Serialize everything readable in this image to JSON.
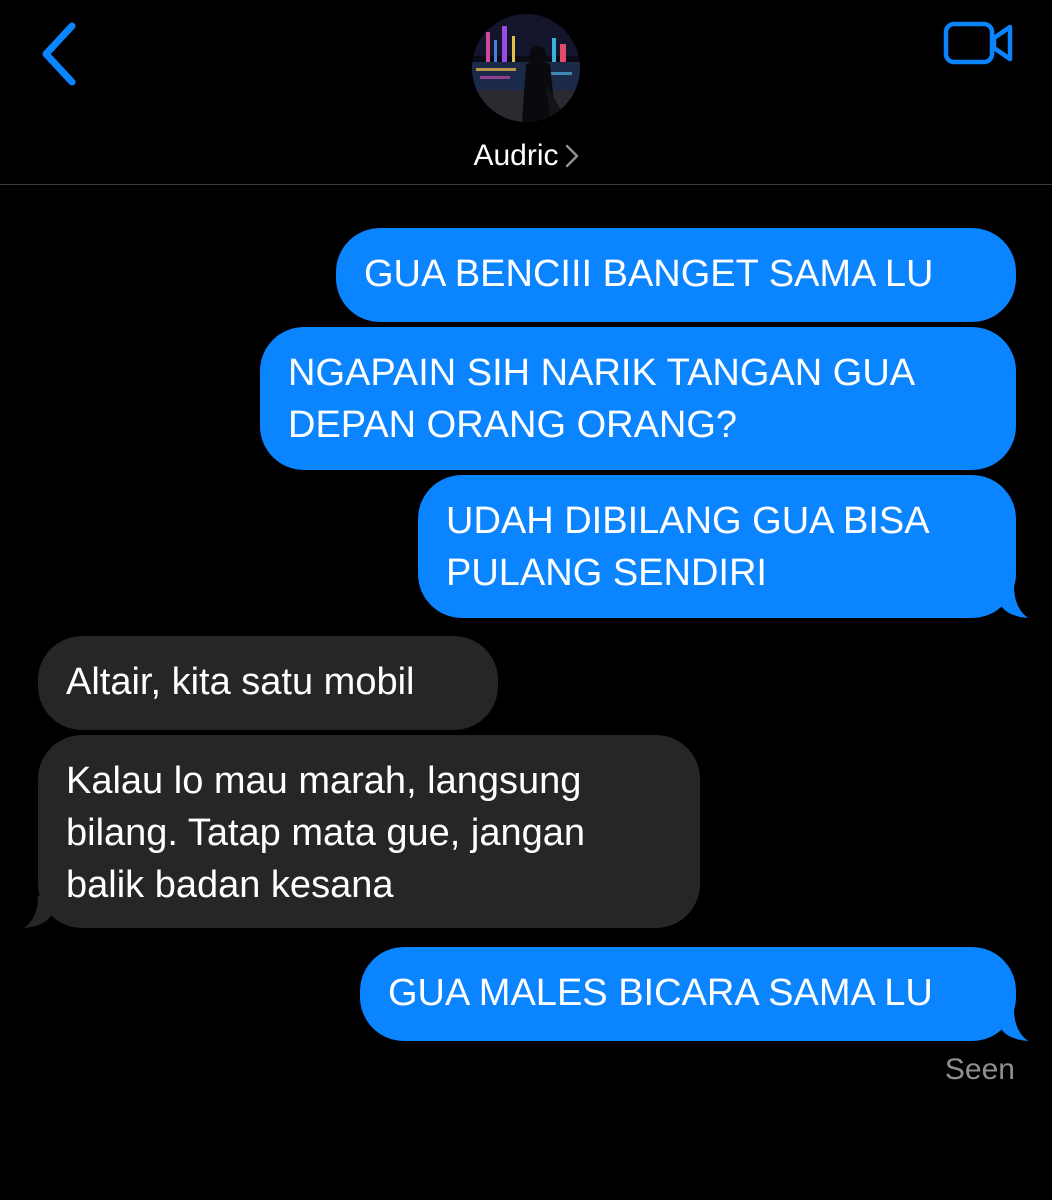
{
  "contact": {
    "name": "Audric"
  },
  "header": {
    "back_icon": "chevron-left-icon",
    "video_icon": "video-camera-icon",
    "accent_color": "#0a84ff"
  },
  "messages": [
    {
      "direction": "outgoing",
      "text": "GUA BENCIII BANGET SAMA LU"
    },
    {
      "direction": "outgoing",
      "lines": [
        "NGAPAIN SIH NARIK TANGAN GUA",
        "DEPAN ORANG ORANG?"
      ]
    },
    {
      "direction": "outgoing",
      "lines": [
        "UDAH DIBILANG GUA BISA",
        "PULANG SENDIRI"
      ]
    },
    {
      "direction": "incoming",
      "text": "Altair, kita satu mobil"
    },
    {
      "direction": "incoming",
      "lines": [
        "Kalau lo mau marah, langsung",
        "bilang. Tatap mata gue, jangan",
        "balik badan kesana"
      ]
    },
    {
      "direction": "outgoing",
      "text": "GUA MALES BICARA SAMA LU"
    }
  ],
  "status": {
    "seen": "Seen"
  },
  "colors": {
    "outgoing_bubble": "#0a84ff",
    "incoming_bubble": "#262628",
    "background": "#000000",
    "secondary_text": "#8e8e93"
  }
}
